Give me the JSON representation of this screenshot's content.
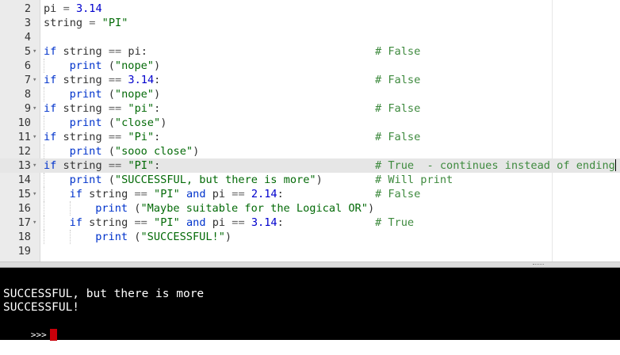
{
  "editor": {
    "lines": [
      {
        "num": "2",
        "fold": false,
        "indent": 0,
        "code": [
          {
            "t": "pi ",
            "c": ""
          },
          {
            "t": "=",
            "c": "op"
          },
          {
            "t": " ",
            "c": ""
          },
          {
            "t": "3.14",
            "c": "num"
          }
        ],
        "comment": ""
      },
      {
        "num": "3",
        "fold": false,
        "indent": 0,
        "code": [
          {
            "t": "string ",
            "c": ""
          },
          {
            "t": "=",
            "c": "op"
          },
          {
            "t": " ",
            "c": ""
          },
          {
            "t": "\"PI\"",
            "c": "str"
          }
        ],
        "comment": ""
      },
      {
        "num": "4",
        "fold": false,
        "indent": 0,
        "code": [],
        "comment": ""
      },
      {
        "num": "5",
        "fold": true,
        "indent": 0,
        "code": [
          {
            "t": "if",
            "c": "kw"
          },
          {
            "t": " string ",
            "c": ""
          },
          {
            "t": "==",
            "c": "op"
          },
          {
            "t": " pi:",
            "c": ""
          }
        ],
        "comment": "# False"
      },
      {
        "num": "6",
        "fold": false,
        "indent": 1,
        "code": [
          {
            "t": "print",
            "c": "fn"
          },
          {
            "t": " (",
            "c": ""
          },
          {
            "t": "\"nope\"",
            "c": "str"
          },
          {
            "t": ")",
            "c": ""
          }
        ],
        "comment": ""
      },
      {
        "num": "7",
        "fold": true,
        "indent": 0,
        "code": [
          {
            "t": "if",
            "c": "kw"
          },
          {
            "t": " string ",
            "c": ""
          },
          {
            "t": "==",
            "c": "op"
          },
          {
            "t": " ",
            "c": ""
          },
          {
            "t": "3.14",
            "c": "num"
          },
          {
            "t": ":",
            "c": ""
          }
        ],
        "comment": "# False"
      },
      {
        "num": "8",
        "fold": false,
        "indent": 1,
        "code": [
          {
            "t": "print",
            "c": "fn"
          },
          {
            "t": " (",
            "c": ""
          },
          {
            "t": "\"nope\"",
            "c": "str"
          },
          {
            "t": ")",
            "c": ""
          }
        ],
        "comment": ""
      },
      {
        "num": "9",
        "fold": true,
        "indent": 0,
        "code": [
          {
            "t": "if",
            "c": "kw"
          },
          {
            "t": " string ",
            "c": ""
          },
          {
            "t": "==",
            "c": "op"
          },
          {
            "t": " ",
            "c": ""
          },
          {
            "t": "\"pi\"",
            "c": "str"
          },
          {
            "t": ":",
            "c": ""
          }
        ],
        "comment": "# False"
      },
      {
        "num": "10",
        "fold": false,
        "indent": 1,
        "code": [
          {
            "t": "print",
            "c": "fn"
          },
          {
            "t": " (",
            "c": ""
          },
          {
            "t": "\"close\"",
            "c": "str"
          },
          {
            "t": ")",
            "c": ""
          }
        ],
        "comment": ""
      },
      {
        "num": "11",
        "fold": true,
        "indent": 0,
        "code": [
          {
            "t": "if",
            "c": "kw"
          },
          {
            "t": " string ",
            "c": ""
          },
          {
            "t": "==",
            "c": "op"
          },
          {
            "t": " ",
            "c": ""
          },
          {
            "t": "\"Pi\"",
            "c": "str"
          },
          {
            "t": ":",
            "c": ""
          }
        ],
        "comment": "# False"
      },
      {
        "num": "12",
        "fold": false,
        "indent": 1,
        "code": [
          {
            "t": "print",
            "c": "fn"
          },
          {
            "t": " (",
            "c": ""
          },
          {
            "t": "\"sooo close\"",
            "c": "str"
          },
          {
            "t": ")",
            "c": ""
          }
        ],
        "comment": ""
      },
      {
        "num": "13",
        "fold": true,
        "indent": 0,
        "active": true,
        "code": [
          {
            "t": "if",
            "c": "kw"
          },
          {
            "t": " string ",
            "c": ""
          },
          {
            "t": "==",
            "c": "op"
          },
          {
            "t": " ",
            "c": ""
          },
          {
            "t": "\"PI\"",
            "c": "str"
          },
          {
            "t": ":",
            "c": ""
          }
        ],
        "comment": "# True  - continues instead of ending"
      },
      {
        "num": "14",
        "fold": false,
        "indent": 1,
        "code": [
          {
            "t": "print",
            "c": "fn"
          },
          {
            "t": " (",
            "c": ""
          },
          {
            "t": "\"SUCCESSFUL, but there is more\"",
            "c": "str"
          },
          {
            "t": ")",
            "c": ""
          }
        ],
        "comment": "# Will print"
      },
      {
        "num": "15",
        "fold": true,
        "indent": 1,
        "code": [
          {
            "t": "if",
            "c": "kw"
          },
          {
            "t": " string ",
            "c": ""
          },
          {
            "t": "==",
            "c": "op"
          },
          {
            "t": " ",
            "c": ""
          },
          {
            "t": "\"PI\"",
            "c": "str"
          },
          {
            "t": " ",
            "c": ""
          },
          {
            "t": "and",
            "c": "kw"
          },
          {
            "t": " pi ",
            "c": ""
          },
          {
            "t": "==",
            "c": "op"
          },
          {
            "t": " ",
            "c": ""
          },
          {
            "t": "2.14",
            "c": "num"
          },
          {
            "t": ":",
            "c": ""
          }
        ],
        "comment": "# False"
      },
      {
        "num": "16",
        "fold": false,
        "indent": 2,
        "code": [
          {
            "t": "print",
            "c": "fn"
          },
          {
            "t": " (",
            "c": ""
          },
          {
            "t": "\"Maybe suitable for the Logical OR\"",
            "c": "str"
          },
          {
            "t": ")",
            "c": ""
          }
        ],
        "comment": ""
      },
      {
        "num": "17",
        "fold": true,
        "indent": 1,
        "code": [
          {
            "t": "if",
            "c": "kw"
          },
          {
            "t": " string ",
            "c": ""
          },
          {
            "t": "==",
            "c": "op"
          },
          {
            "t": " ",
            "c": ""
          },
          {
            "t": "\"PI\"",
            "c": "str"
          },
          {
            "t": " ",
            "c": ""
          },
          {
            "t": "and",
            "c": "kw"
          },
          {
            "t": " pi ",
            "c": ""
          },
          {
            "t": "==",
            "c": "op"
          },
          {
            "t": " ",
            "c": ""
          },
          {
            "t": "3.14",
            "c": "num"
          },
          {
            "t": ":",
            "c": ""
          }
        ],
        "comment": "# True"
      },
      {
        "num": "18",
        "fold": false,
        "indent": 2,
        "code": [
          {
            "t": "print",
            "c": "fn"
          },
          {
            "t": " (",
            "c": ""
          },
          {
            "t": "\"SUCCESSFUL!\"",
            "c": "str"
          },
          {
            "t": ")",
            "c": ""
          }
        ],
        "comment": ""
      },
      {
        "num": "19",
        "fold": false,
        "indent": 0,
        "code": [],
        "comment": ""
      }
    ],
    "colors": {
      "keyword": "#0033cc",
      "string": "#036a07",
      "number": "#0000cd",
      "comment": "#3e8a3e",
      "active_line": "#e6e6e6",
      "gutter": "#ebebeb"
    }
  },
  "console": {
    "output": [
      "SUCCESSFUL, but there is more",
      "SUCCESSFUL!"
    ],
    "prompt": ">>>",
    "cursor_color": "#c8000a"
  }
}
